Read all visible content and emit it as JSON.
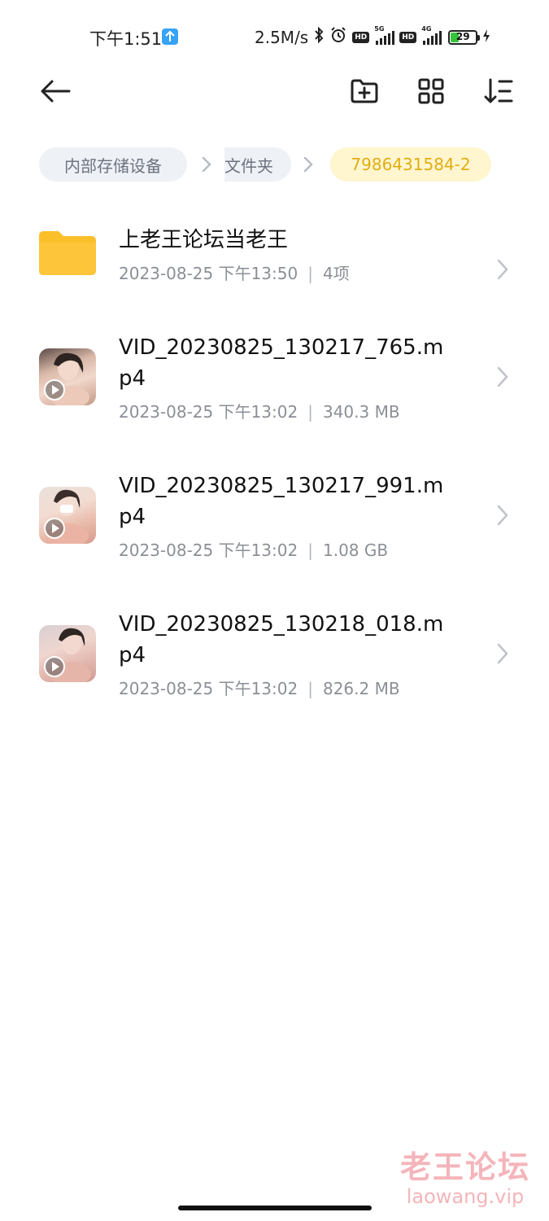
{
  "status_bar": {
    "time": "下午1:51",
    "speed": "2.5M/s",
    "hd_label": "HD",
    "network_5g": "5G",
    "network_4g": "4G",
    "battery": "29"
  },
  "toolbar": {
    "icons": [
      "back-arrow-icon",
      "new-folder-icon",
      "grid-view-icon",
      "sort-icon"
    ]
  },
  "breadcrumb": {
    "items": [
      "内部存储设备",
      "文件夹",
      "7986431584-2"
    ]
  },
  "files": [
    {
      "type": "folder",
      "name": "上老王论坛当老王",
      "date": "2023-08-25 下午13:50",
      "info": "4项"
    },
    {
      "type": "video",
      "name": "VID_20230825_130217_765.mp4",
      "date": "2023-08-25 下午13:02",
      "info": "340.3 MB"
    },
    {
      "type": "video",
      "name": "VID_20230825_130217_991.mp4",
      "date": "2023-08-25 下午13:02",
      "info": "1.08 GB"
    },
    {
      "type": "video",
      "name": "VID_20230825_130218_018.mp4",
      "date": "2023-08-25 下午13:02",
      "info": "826.2 MB"
    }
  ],
  "meta_separator": "|",
  "watermark": {
    "cn": "老王论坛",
    "en": "laowang.vip"
  },
  "colors": {
    "accent": "#e2ad13",
    "folder": "#fbbf2a",
    "current_crumb_bg": "#fff6cf"
  }
}
